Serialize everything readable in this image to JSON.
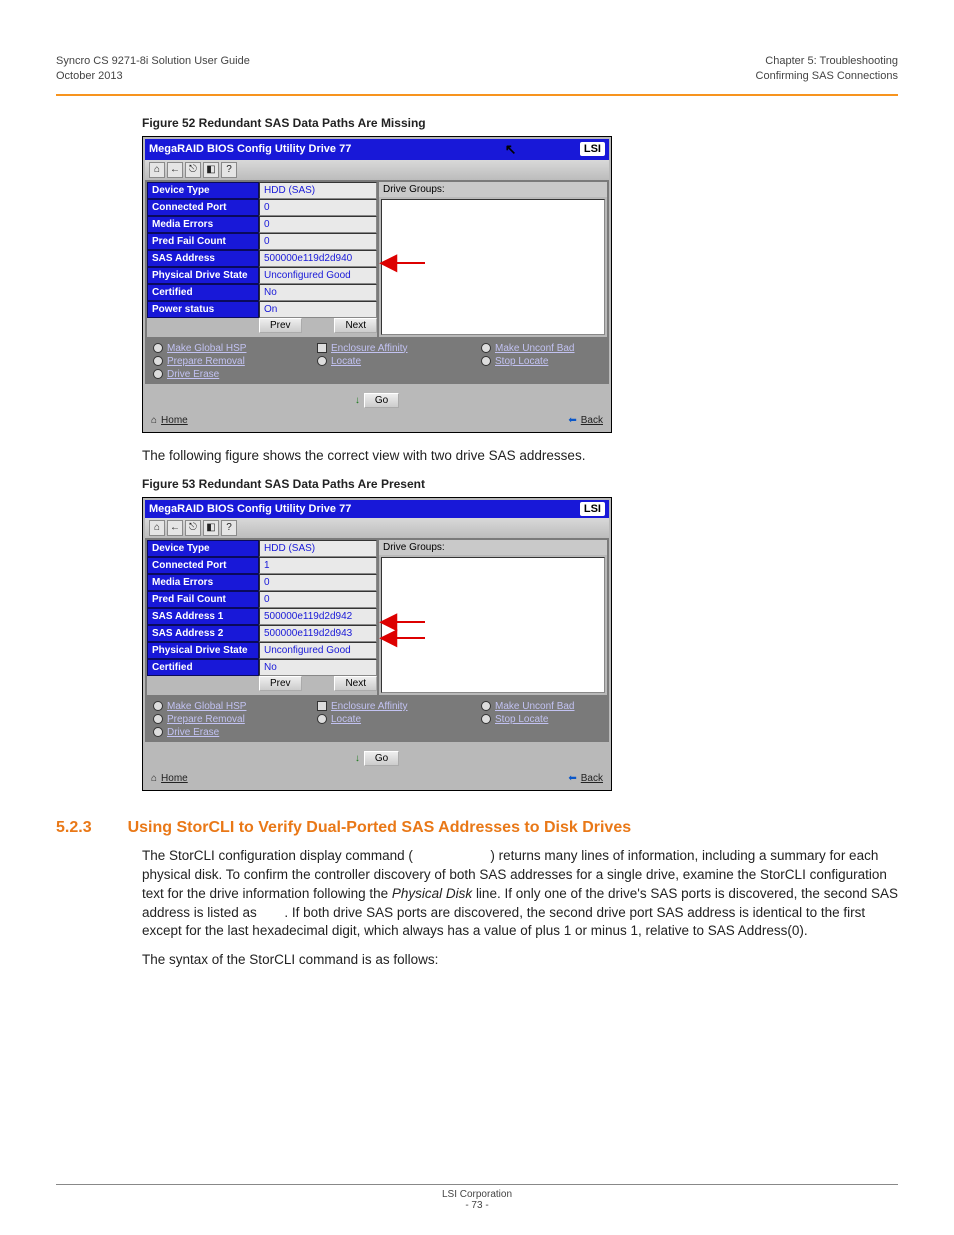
{
  "header": {
    "left_line1": "Syncro CS 9271-8i Solution User Guide",
    "left_line2": "October 2013",
    "right_line1": "Chapter 5:  Troubleshooting",
    "right_line2": "Confirming SAS Connections"
  },
  "fig52": {
    "caption": "Figure 52  Redundant SAS Data Paths Are Missing",
    "title": "MegaRAID BIOS Config Utility  Drive 77",
    "logo": "LSI",
    "drive_groups": "Drive Groups:",
    "props": [
      {
        "label": "Device Type",
        "value": "HDD (SAS)"
      },
      {
        "label": "Connected Port",
        "value": "0"
      },
      {
        "label": "Media Errors",
        "value": "0"
      },
      {
        "label": "Pred Fail Count",
        "value": "0"
      },
      {
        "label": "SAS Address",
        "value": "500000e119d2d940"
      },
      {
        "label": "Physical Drive State",
        "value": "Unconfigured Good"
      },
      {
        "label": "Certified",
        "value": "No"
      },
      {
        "label": "Power status",
        "value": "On"
      }
    ],
    "prev": "Prev",
    "next": "Next",
    "options": {
      "col1": [
        "Make Global HSP",
        "Prepare Removal",
        "Drive Erase"
      ],
      "col2": [
        "Enclosure Affinity",
        "Locate"
      ],
      "col3": [
        "Make Unconf Bad",
        "Stop Locate"
      ]
    },
    "go": "Go",
    "home": "Home",
    "back": "Back"
  },
  "between": "The following figure shows the correct view with two drive SAS addresses.",
  "fig53": {
    "caption": "Figure 53  Redundant SAS Data Paths Are Present",
    "title": "MegaRAID BIOS Config Utility  Drive 77",
    "logo": "LSI",
    "drive_groups": "Drive Groups:",
    "props": [
      {
        "label": "Device Type",
        "value": "HDD (SAS)"
      },
      {
        "label": "Connected Port",
        "value": "1"
      },
      {
        "label": "Media Errors",
        "value": "0"
      },
      {
        "label": "Pred Fail Count",
        "value": "0"
      },
      {
        "label": "SAS Address 1",
        "value": "500000e119d2d942"
      },
      {
        "label": "SAS Address 2",
        "value": "500000e119d2d943"
      },
      {
        "label": "Physical Drive State",
        "value": "Unconfigured Good"
      },
      {
        "label": "Certified",
        "value": "No"
      }
    ],
    "prev": "Prev",
    "next": "Next",
    "options": {
      "col1": [
        "Make Global HSP",
        "Prepare Removal",
        "Drive Erase"
      ],
      "col2": [
        "Enclosure Affinity",
        "Locate"
      ],
      "col3": [
        "Make Unconf Bad",
        "Stop Locate"
      ]
    },
    "go": "Go",
    "home": "Home",
    "back": "Back"
  },
  "section": {
    "num": "5.2.3",
    "title": "Using StorCLI to Verify Dual-Ported SAS Addresses to Disk Drives",
    "p1_a": "The StorCLI configuration display command (",
    "p1_b": ") returns many lines of information, including a summary for each physical disk. To confirm the controller discovery of both SAS addresses for a single drive, examine the StorCLI configuration text for the drive information following the ",
    "p1_term": "Physical Disk",
    "p1_c": " line. If only one of the drive's SAS ports is discovered, the second SAS address is listed as ",
    "p1_d": ". If both drive SAS ports are discovered, the second drive port SAS address is identical to the first except for the last hexadecimal digit, which always has a value of plus 1 or minus 1, relative to SAS Address(0).",
    "p2": "The syntax of the StorCLI command is as follows:"
  },
  "footer": {
    "corp": "LSI Corporation",
    "page": "- 73 -"
  }
}
